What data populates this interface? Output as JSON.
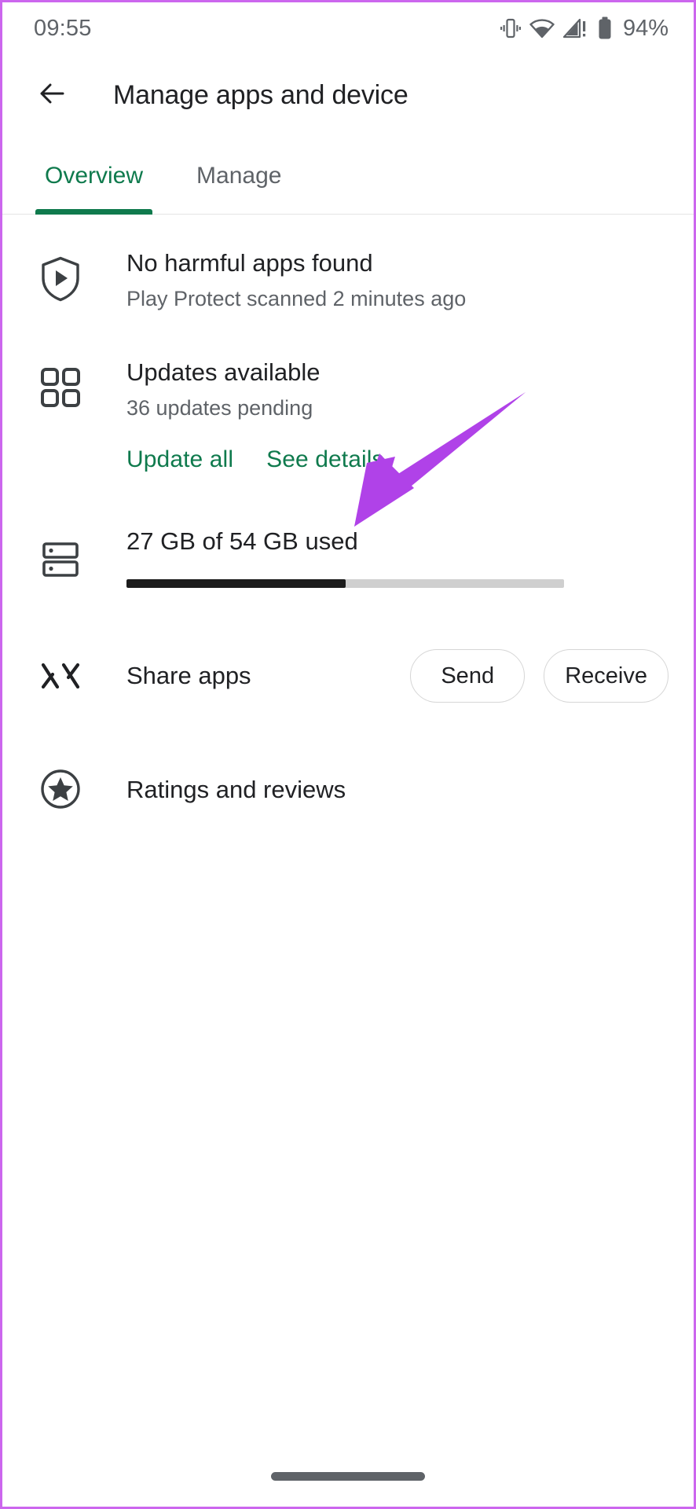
{
  "colors": {
    "accent_green": "#0f7a4d",
    "annotation_purple": "#b042e8",
    "text_primary": "#202124",
    "text_secondary": "#5f6368",
    "storage_fill": "#1c1c1c",
    "storage_track": "#cfcfcf",
    "frame_border": "#cc66ee"
  },
  "status_bar": {
    "clock": "09:55",
    "battery_percent": "94%",
    "icons": [
      "vibrate-icon",
      "wifi-icon",
      "cellular-signal-warning-icon",
      "battery-icon"
    ]
  },
  "app_bar": {
    "back_icon": "back-arrow-icon",
    "title": "Manage apps and device"
  },
  "tabs": [
    {
      "label": "Overview",
      "active": true
    },
    {
      "label": "Manage",
      "active": false
    }
  ],
  "rows": {
    "play_protect": {
      "icon": "play-protect-shield-icon",
      "title": "No harmful apps found",
      "subtitle": "Play Protect scanned 2 minutes ago"
    },
    "updates": {
      "icon": "apps-grid-icon",
      "title": "Updates available",
      "subtitle": "36 updates pending",
      "actions": [
        {
          "label": "Update all"
        },
        {
          "label": "See details"
        }
      ]
    },
    "storage": {
      "icon": "storage-icon",
      "title": "27 GB of 54 GB used",
      "used_gb": 27,
      "total_gb": 54,
      "fill_percent": "50%"
    },
    "share": {
      "icon": "nearby-share-icon",
      "label": "Share apps",
      "buttons": [
        {
          "label": "Send"
        },
        {
          "label": "Receive"
        }
      ]
    },
    "ratings": {
      "icon": "star-circle-icon",
      "label": "Ratings and reviews"
    }
  },
  "annotation": {
    "type": "arrow",
    "points_to": "See details",
    "color": "#b042e8"
  },
  "gesture_nav": {
    "handle": "home-gesture-pill"
  }
}
